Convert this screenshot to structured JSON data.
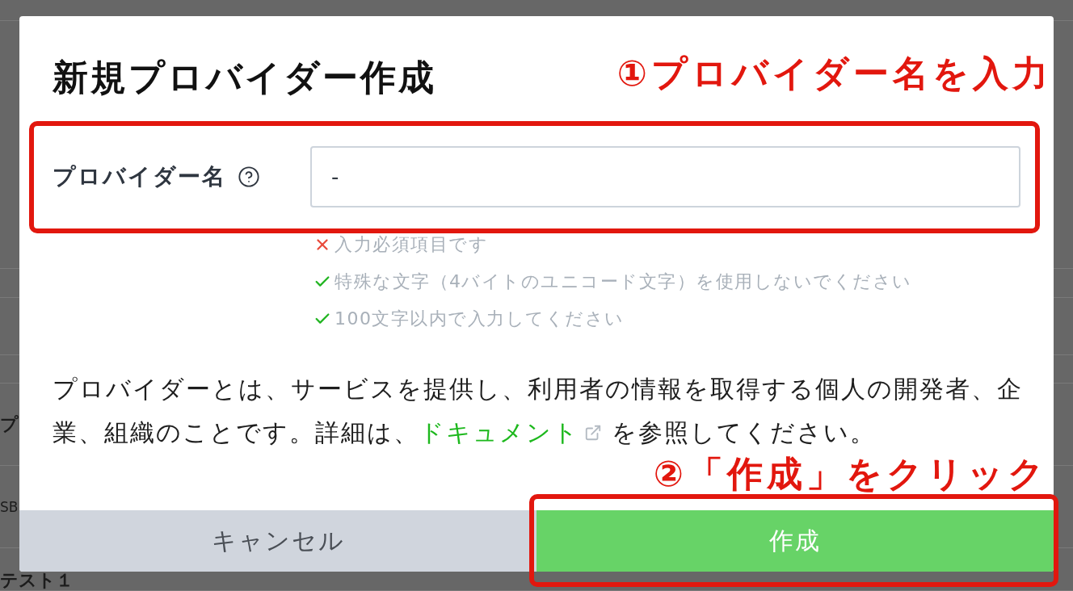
{
  "background_page": {
    "row_labels": [
      "プ",
      "SB",
      "テスト１"
    ]
  },
  "dialog": {
    "title": "新規プロバイダー作成",
    "field": {
      "label": "プロバイダー名",
      "value": "-"
    },
    "rules": [
      {
        "text": "入力必須項目です",
        "passed": false
      },
      {
        "text": "特殊な文字（4バイトのユニコード文字）を使用しないでください",
        "passed": true
      },
      {
        "text": "100文字以内で入力してください",
        "passed": true
      }
    ],
    "description": {
      "text_before": "プロバイダーとは、サービスを提供し、利用者の情報を取得する個人の開発者、企業、組織のことです。詳細は、",
      "link": "ドキュメント",
      "text_after": "を参照してください。"
    },
    "buttons": [
      {
        "label": "キャンセル",
        "kind": "secondary"
      },
      {
        "label": "作成",
        "kind": "primary"
      }
    ]
  },
  "annotations": [
    {
      "text": "①プロバイダー名を入力",
      "kind": "field"
    },
    {
      "text": "②「作成」をクリック",
      "kind": "button"
    }
  ]
}
